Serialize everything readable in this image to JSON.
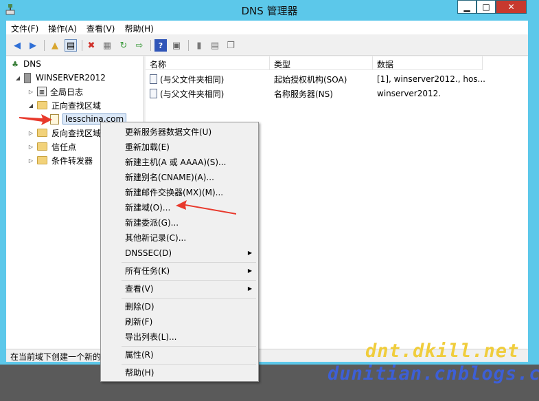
{
  "window": {
    "title": "DNS 管理器",
    "min_label": "▁",
    "max_label": "□",
    "close_label": "✕"
  },
  "menubar": [
    "文件(F)",
    "操作(A)",
    "查看(V)",
    "帮助(H)"
  ],
  "tree": {
    "root": "DNS",
    "server": "WINSERVER2012",
    "global_logs": "全局日志",
    "forward_zones": "正向查找区域",
    "zone": "lesschina.com",
    "reverse_zones": "反向查找区域",
    "trust_points": "信任点",
    "conditional_forwarders": "条件转发器"
  },
  "list": {
    "columns": [
      "名称",
      "类型",
      "数据"
    ],
    "rows": [
      [
        "(与父文件夹相同)",
        "起始授权机构(SOA)",
        "[1], winserver2012., hos..."
      ],
      [
        "(与父文件夹相同)",
        "名称服务器(NS)",
        "winserver2012."
      ]
    ]
  },
  "status": "在当前域下创建一个新的",
  "context_menu": {
    "items": [
      "更新服务器数据文件(U)",
      "重新加载(E)",
      "新建主机(A 或 AAAA)(S)...",
      "新建别名(CNAME)(A)...",
      "新建邮件交换器(MX)(M)...",
      "新建域(O)...",
      "新建委派(G)...",
      "其他新记录(C)...",
      "DNSSEC(D)",
      "所有任务(K)",
      "查看(V)",
      "删除(D)",
      "刷新(F)",
      "导出列表(L)...",
      "属性(R)",
      "帮助(H)"
    ]
  },
  "watermark": {
    "line1": "dnt.dkill.net",
    "line2": "dunitian.cnblogs.com"
  },
  "colors": {
    "title_bar": "#5cc8ea",
    "close_button": "#c7392e",
    "arrow": "#e8392c",
    "watermark1": "#f0cd3c",
    "watermark2": "#3d5fd6"
  }
}
